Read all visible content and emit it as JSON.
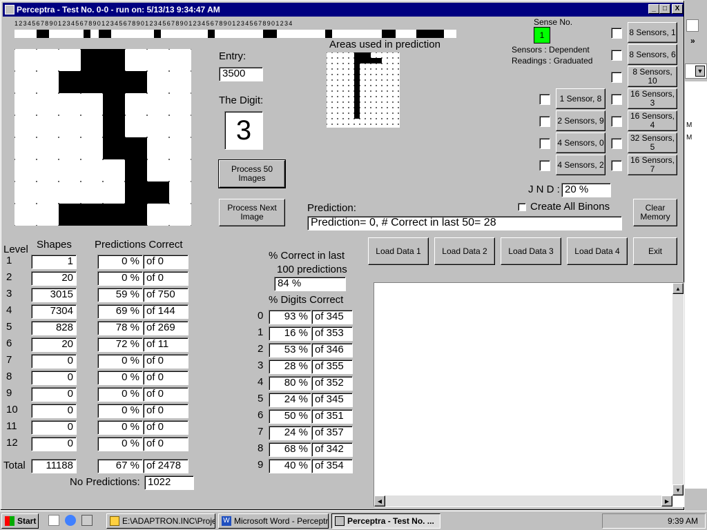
{
  "window": {
    "title": "Perceptra - Test No. 0-0 - run on: 5/13/13  9:34:47 AM",
    "min": "_",
    "max": "□",
    "close": "X"
  },
  "ruler": "1 2 3 4 5 6 7 8 9 0 1 2 3 4 5 6 7 8 9 0 1 2 3 4 5 6 7 8 9 0 1 2 3 4 5 6 7 8 9 0 1 2 3 4 5 6 7 8 9 0 1 2 3 4 5 6 7 8 9 0 1 2 3 4",
  "entry": {
    "label": "Entry:",
    "value": "3500"
  },
  "digit": {
    "label": "The Digit:",
    "value": "3"
  },
  "areas_label": "Areas used in prediction",
  "buttons": {
    "process50": "Process 50 Images",
    "processNext": "Process Next Image",
    "clear": "Clear Memory",
    "load1": "Load Data 1",
    "load2": "Load Data 2",
    "load3": "Load Data 3",
    "load4": "Load Data 4",
    "exit": "Exit"
  },
  "sense": {
    "label": "Sense No.",
    "value": "1",
    "sensors": "Sensors  :  Dependent",
    "readings": "Readings : Graduated",
    "color": "#00ff00"
  },
  "sensor_buttons_right": [
    "8 Sensors, 1",
    "8 Sensors, 6",
    "8 Sensors, 10",
    "16 Sensors, 3",
    "16 Sensors, 4",
    "32 Sensors, 5",
    "16 Sensors, 7"
  ],
  "sensor_buttons_left": [
    "1 Sensor, 8",
    "2 Sensors, 9",
    "4 Sensors, 0",
    "4 Sensors, 2"
  ],
  "jnd": {
    "label": "J N D :",
    "value": "20 %"
  },
  "create_binons": "Create All Binons",
  "prediction": {
    "label": "Prediction:",
    "value": "Prediction= 0, # Correct in last 50= 28"
  },
  "levels": {
    "h_level": "Level",
    "h_shapes": "Shapes",
    "h_pred": "Predictions Correct",
    "rows": [
      {
        "level": "1",
        "shapes": "1",
        "pct": "0 %",
        "of": "of 0"
      },
      {
        "level": "2",
        "shapes": "20",
        "pct": "0 %",
        "of": "of 0"
      },
      {
        "level": "3",
        "shapes": "3015",
        "pct": "59 %",
        "of": "of 750"
      },
      {
        "level": "4",
        "shapes": "7304",
        "pct": "69 %",
        "of": "of 144"
      },
      {
        "level": "5",
        "shapes": "828",
        "pct": "78 %",
        "of": "of 269"
      },
      {
        "level": "6",
        "shapes": "20",
        "pct": "72 %",
        "of": "of 11"
      },
      {
        "level": "7",
        "shapes": "0",
        "pct": "0 %",
        "of": "of 0"
      },
      {
        "level": "8",
        "shapes": "0",
        "pct": "0 %",
        "of": "of 0"
      },
      {
        "level": "9",
        "shapes": "0",
        "pct": "0 %",
        "of": "of 0"
      },
      {
        "level": "10",
        "shapes": "0",
        "pct": "0 %",
        "of": "of 0"
      },
      {
        "level": "11",
        "shapes": "0",
        "pct": "0 %",
        "of": "of 0"
      },
      {
        "level": "12",
        "shapes": "0",
        "pct": "0 %",
        "of": "of 0"
      }
    ],
    "total_label": "Total",
    "total_shapes": "11188",
    "total_pct": "67 %",
    "total_of": "of 2478",
    "nopred_label": "No Predictions:",
    "nopred_value": "1022"
  },
  "last100": {
    "label1": "% Correct in last",
    "label2": "100 predictions",
    "value": "84 %"
  },
  "digits": {
    "label": "% Digits Correct",
    "rows": [
      {
        "d": "0",
        "pct": "93 %",
        "of": "of 345"
      },
      {
        "d": "1",
        "pct": "16 %",
        "of": "of 353"
      },
      {
        "d": "2",
        "pct": "53 %",
        "of": "of 346"
      },
      {
        "d": "3",
        "pct": "28 %",
        "of": "of 355"
      },
      {
        "d": "4",
        "pct": "80 %",
        "of": "of 352"
      },
      {
        "d": "5",
        "pct": "24 %",
        "of": "of 345"
      },
      {
        "d": "6",
        "pct": "50 %",
        "of": "of 351"
      },
      {
        "d": "7",
        "pct": "24 %",
        "of": "of 357"
      },
      {
        "d": "8",
        "pct": "68 %",
        "of": "of 342"
      },
      {
        "d": "9",
        "pct": "40 %",
        "of": "of 354"
      }
    ]
  },
  "side": {
    "m1": "M",
    "m2": "M"
  },
  "taskbar": {
    "start": "Start",
    "items": [
      "E:\\ADAPTRON.INC\\Proje...",
      "Microsoft Word - Perceptra...",
      "Perceptra - Test No. ..."
    ],
    "clock": "9:39 AM"
  }
}
